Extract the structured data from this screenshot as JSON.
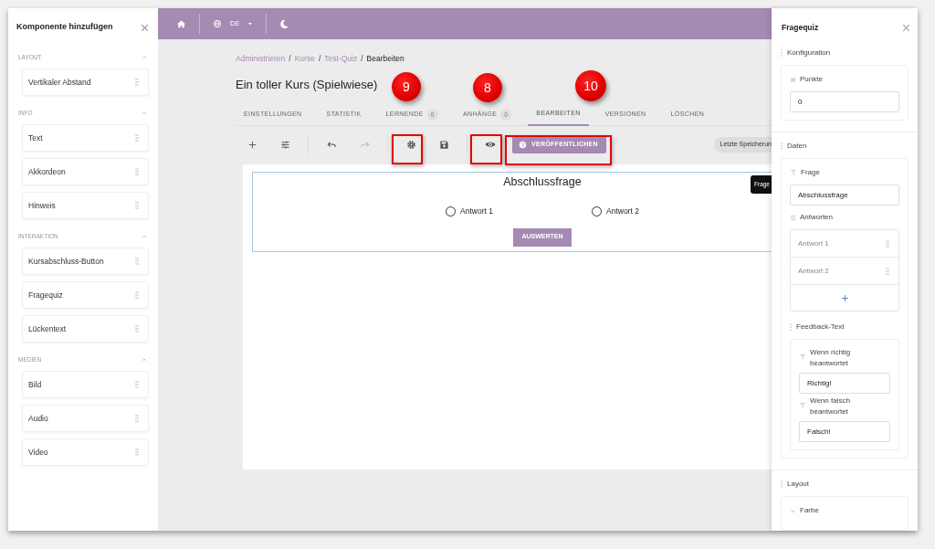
{
  "left_panel": {
    "title": "Komponente hinzufügen",
    "sections": [
      {
        "label": "LAYOUT",
        "expanded": true,
        "items": [
          "Vertikaler Abstand"
        ]
      },
      {
        "label": "INFO",
        "expanded": true,
        "items": [
          "Text",
          "Akkordeon",
          "Hinweis"
        ]
      },
      {
        "label": "INTERAKTION",
        "expanded": true,
        "items": [
          "Kursabschluss-Button",
          "Fragequiz",
          "Lückentext"
        ]
      },
      {
        "label": "MEDIEN",
        "expanded": true,
        "items": [
          "Bild",
          "Audio",
          "Video"
        ]
      }
    ]
  },
  "top_bar": {
    "language": "DE"
  },
  "breadcrumb": [
    {
      "kind": "link",
      "label": "Administrieren"
    },
    {
      "kind": "separator",
      "label": "/"
    },
    {
      "kind": "link",
      "label": "Kurse"
    },
    {
      "kind": "separator",
      "label": "/"
    },
    {
      "kind": "link",
      "label": "Test-Quiz"
    },
    {
      "kind": "separator",
      "label": "/"
    },
    {
      "kind": "current",
      "label": "Bearbeiten"
    }
  ],
  "page_title": "Ein toller Kurs (Spielwiese)",
  "tabs": [
    {
      "label": "EINSTELLUNGEN",
      "selected": false
    },
    {
      "label": "STATISTIK",
      "selected": false
    },
    {
      "label": "LERNENDE",
      "count": "0",
      "selected": false
    },
    {
      "label": "ANHÄNGE",
      "count": "0",
      "selected": false
    },
    {
      "label": "BEARBEITEN",
      "selected": true
    },
    {
      "label": "VERSIONEN",
      "selected": false
    },
    {
      "label": "LÖSCHEN",
      "selected": false
    }
  ],
  "toolbar": {
    "redo_disabled": true,
    "publish_label": "VERÖFFENTLICHEN",
    "last_saved": "Letzte Speicherun"
  },
  "canvas": {
    "question": "Abschlussfrage",
    "answers": [
      {
        "label": "Antwort 1",
        "selected": false
      },
      {
        "label": "Antwort 2",
        "selected": false
      }
    ],
    "submit": "AUSWERTEN",
    "tooltip": "Frage"
  },
  "callouts": [
    {
      "number": "9"
    },
    {
      "number": "8"
    },
    {
      "number": "10"
    }
  ],
  "right_panel": {
    "title": "Fragequiz",
    "configuration": {
      "label": "Konfiguration",
      "points_label": "Punkte",
      "points_value": "0"
    },
    "data": {
      "label": "Daten",
      "question_label": "Frage",
      "question_value": "Abschlussfrage",
      "answers_label": "Antworten",
      "answers": [
        "Antwort 1",
        "Antwort 2"
      ],
      "feedback_label": "Feedback-Text",
      "correct_label": "Wenn richtig beantwortet",
      "correct_value": "Richtig!",
      "wrong_label": "Wenn falsch beantwortet",
      "wrong_value": "Falsch!"
    },
    "layout": {
      "label": "Layout",
      "color_label": "Farbe",
      "expanded": false
    }
  }
}
